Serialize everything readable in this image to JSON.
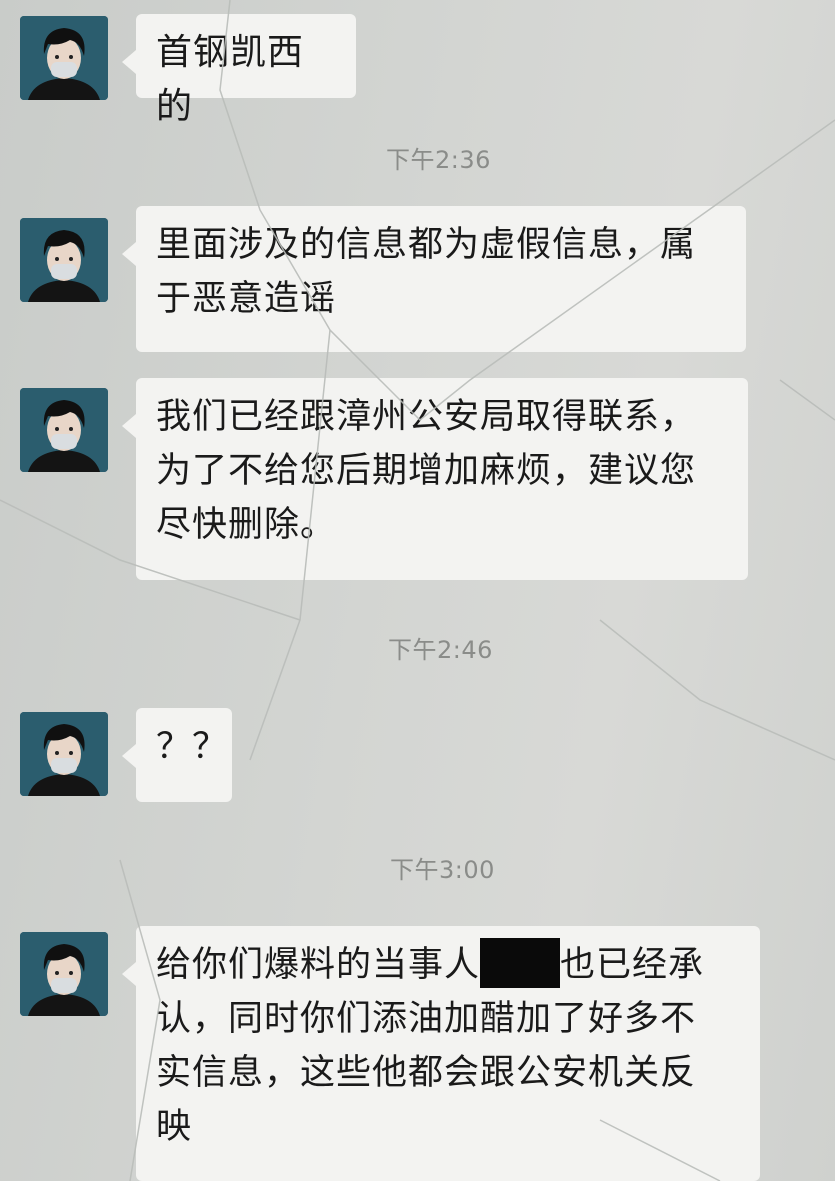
{
  "messages": [
    {
      "type": "incoming",
      "avatar": "user-avatar",
      "text": "首钢凯西的"
    },
    {
      "type": "time",
      "text": "下午2:36"
    },
    {
      "type": "incoming",
      "avatar": "user-avatar",
      "line1": "里面涉及的信息都为虚假信息，属",
      "line2": "于恶意造谣"
    },
    {
      "type": "incoming",
      "avatar": "user-avatar",
      "line1": "我们已经跟漳州公安局取得联系，",
      "line2": "为了不给您后期增加麻烦，建议您",
      "line3": "尽快删除。"
    },
    {
      "type": "time",
      "text": "下午2:46"
    },
    {
      "type": "incoming",
      "avatar": "user-avatar",
      "text": "？？"
    },
    {
      "type": "time",
      "text": "下午3:00"
    },
    {
      "type": "incoming",
      "avatar": "user-avatar",
      "line1_before": "给你们爆料的当事人",
      "line1_after": "也已经承",
      "line2": "认，同时你们添油加醋加了好多不",
      "line3": "实信息，这些他都会跟公安机关反",
      "line4": "映"
    }
  ],
  "colors": {
    "background": "#d3d5d2",
    "bubble": "#f3f3f1",
    "timestamp": "#8a8c89",
    "avatar_bg": "#2b5d6e"
  }
}
